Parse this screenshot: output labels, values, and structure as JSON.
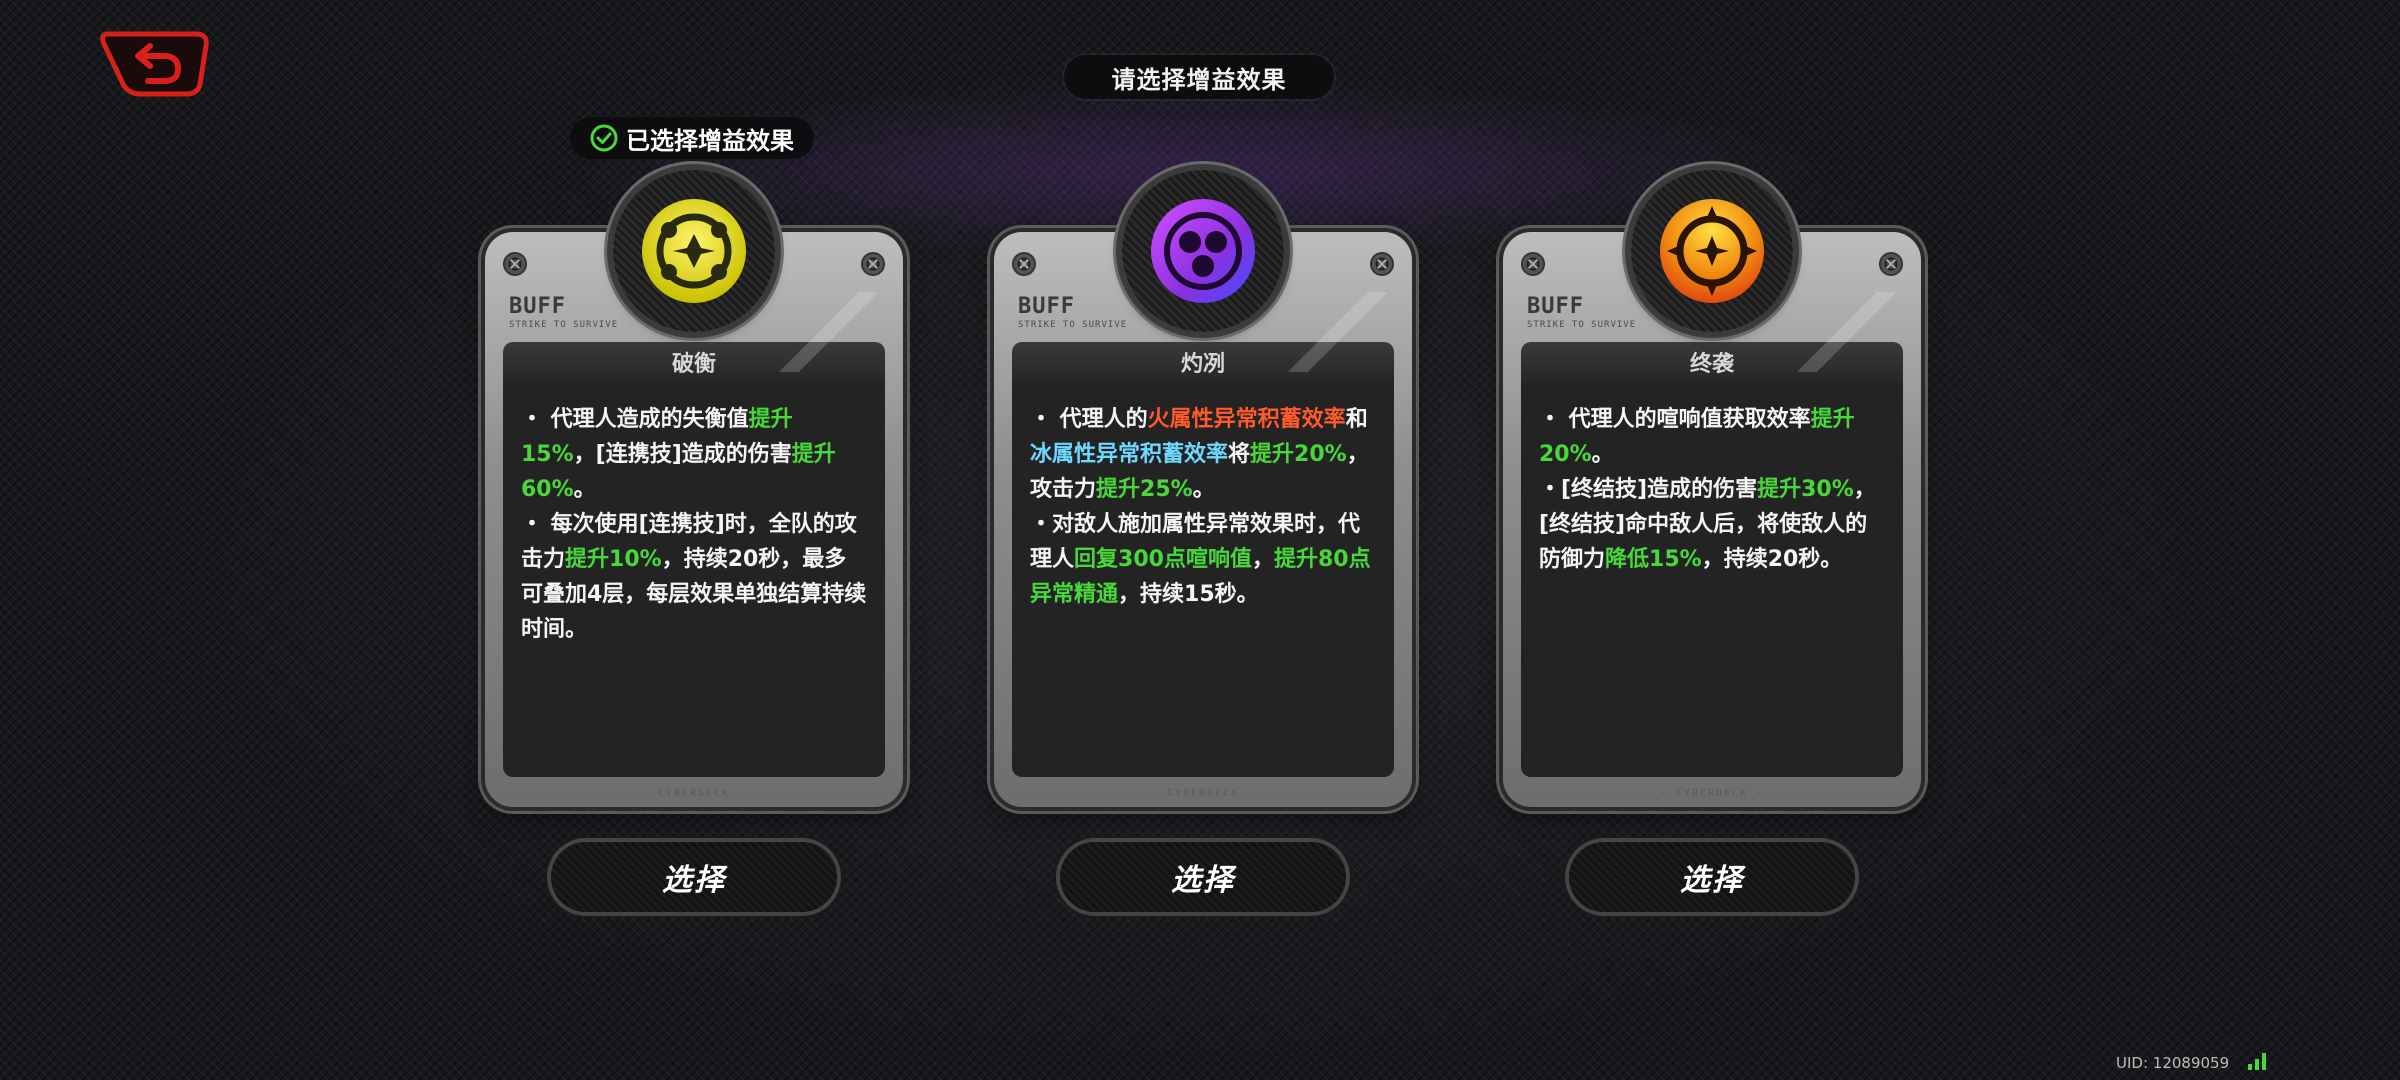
{
  "header": {
    "title": "请选择增益效果"
  },
  "selected_badge": {
    "label": "已选择增益效果"
  },
  "cards": [
    {
      "buff_label": "BUFF",
      "buff_sub": "STRIKE TO SURVIVE",
      "title": "破衡",
      "footer": "· CYBERDECK ·",
      "icon_color": "#e8e020",
      "lines": [
        [
          {
            "t": "・ 代理人造成的失衡值"
          },
          {
            "t": "提升15%",
            "c": "g"
          },
          {
            "t": "，[连携技]造成的伤害"
          },
          {
            "t": "提升60%",
            "c": "g"
          },
          {
            "t": "。"
          }
        ],
        [
          {
            "t": "・ 每次使用[连携技]时，全队的攻击力"
          },
          {
            "t": "提升10%",
            "c": "g"
          },
          {
            "t": "，持续20秒，最多可叠加4层，每层效果单独结算持续时间。"
          }
        ]
      ],
      "button": "选择"
    },
    {
      "buff_label": "BUFF",
      "buff_sub": "STRIKE TO SURVIVE",
      "title": "灼冽",
      "footer": "· CYBERDECK ·",
      "icon_color": "#9a40e8",
      "lines": [
        [
          {
            "t": "・ 代理人的"
          },
          {
            "t": "火属性异常积蓄效率",
            "c": "o"
          },
          {
            "t": "和"
          },
          {
            "t": "冰属性异常积蓄效率",
            "c": "b"
          },
          {
            "t": "将"
          },
          {
            "t": "提升20%",
            "c": "g"
          },
          {
            "t": "，攻击力"
          },
          {
            "t": "提升25%",
            "c": "g"
          },
          {
            "t": "。"
          }
        ],
        [
          {
            "t": "・对敌人施加属性异常效果时，代理人"
          },
          {
            "t": "回复300点喧响值",
            "c": "g"
          },
          {
            "t": "，"
          },
          {
            "t": "提升80点异常精通",
            "c": "g"
          },
          {
            "t": "，持续15秒。"
          }
        ]
      ],
      "button": "选择"
    },
    {
      "buff_label": "BUFF",
      "buff_sub": "STRIKE TO SURVIVE",
      "title": "终袭",
      "footer": "· CYBERDECK ·",
      "icon_color": "#f08a10",
      "lines": [
        [
          {
            "t": "・ 代理人的喧响值获取效率"
          },
          {
            "t": "提升20%",
            "c": "g"
          },
          {
            "t": "。"
          }
        ],
        [
          {
            "t": "・[终结技]造成的伤害"
          },
          {
            "t": "提升30%",
            "c": "g"
          },
          {
            "t": "，[终结技]命中敌人后，将使敌人的防御力"
          },
          {
            "t": "降低15%",
            "c": "g"
          },
          {
            "t": "，持续20秒。"
          }
        ]
      ],
      "button": "选择"
    }
  ],
  "footer": {
    "uid": "UID: 12089059"
  },
  "colors": {
    "highlight_green": "#48d83a",
    "fire_orange": "#ff5a2a",
    "ice_blue": "#6fd8ff",
    "back_red": "#d8201a"
  }
}
